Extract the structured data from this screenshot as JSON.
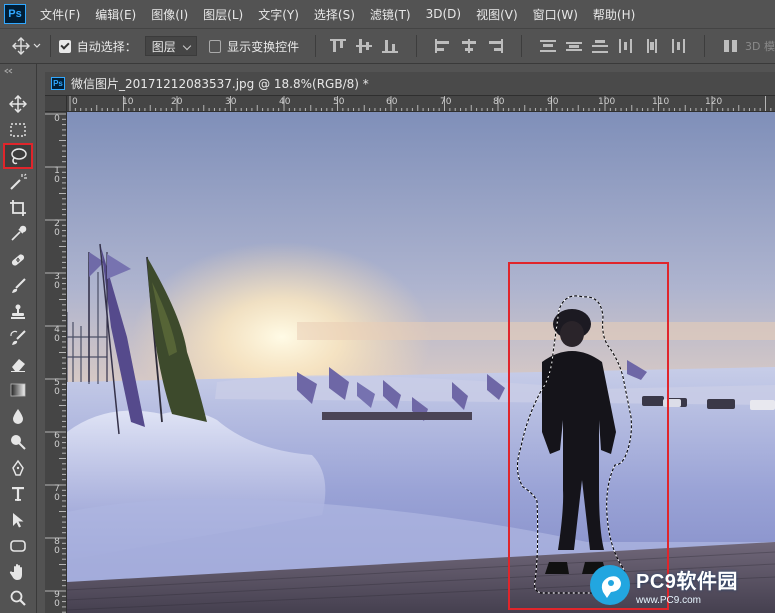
{
  "app": {
    "logo": "Ps"
  },
  "menu": [
    "文件(F)",
    "编辑(E)",
    "图像(I)",
    "图层(L)",
    "文字(Y)",
    "选择(S)",
    "滤镜(T)",
    "3D(D)",
    "视图(V)",
    "窗口(W)",
    "帮助(H)"
  ],
  "options": {
    "auto_select_label": "自动选择：",
    "auto_select_checked": true,
    "auto_select_value": "图层",
    "show_transform_label": "显示变换控件",
    "show_transform_checked": false,
    "mode_3d_label": "3D 模"
  },
  "tools": [
    {
      "name": "move-tool",
      "icon": "move-icon"
    },
    {
      "name": "marquee-tool",
      "icon": "rect-marquee-icon"
    },
    {
      "name": "lasso-tool",
      "icon": "lasso-icon",
      "active": true
    },
    {
      "name": "magic-wand-tool",
      "icon": "magic-wand-icon"
    },
    {
      "name": "crop-tool",
      "icon": "crop-icon"
    },
    {
      "name": "eyedropper-tool",
      "icon": "eyedropper-icon"
    },
    {
      "name": "healing-brush-tool",
      "icon": "bandage-icon"
    },
    {
      "name": "brush-tool",
      "icon": "brush-icon"
    },
    {
      "name": "clone-stamp-tool",
      "icon": "stamp-icon"
    },
    {
      "name": "history-brush-tool",
      "icon": "history-brush-icon"
    },
    {
      "name": "eraser-tool",
      "icon": "eraser-icon"
    },
    {
      "name": "gradient-tool",
      "icon": "gradient-icon"
    },
    {
      "name": "blur-tool",
      "icon": "drop-icon"
    },
    {
      "name": "dodge-tool",
      "icon": "dodge-icon"
    },
    {
      "name": "pen-tool",
      "icon": "pen-icon"
    },
    {
      "name": "type-tool",
      "icon": "type-icon"
    },
    {
      "name": "path-selection-tool",
      "icon": "arrow-icon"
    },
    {
      "name": "shape-tool",
      "icon": "rounded-rect-icon"
    },
    {
      "name": "hand-tool",
      "icon": "hand-icon"
    },
    {
      "name": "zoom-tool",
      "icon": "zoom-icon"
    }
  ],
  "document": {
    "title": "微信图片_20171212083537.jpg @ 18.8%(RGB/8) *",
    "ruler_h": [
      "0",
      "10",
      "20",
      "30",
      "40",
      "50",
      "60",
      "70",
      "80",
      "90",
      "100",
      "110",
      "120"
    ],
    "ruler_v": [
      "0",
      "10",
      "20",
      "30",
      "40",
      "50",
      "60",
      "70",
      "80",
      "90"
    ]
  },
  "highlight_color": "#e0252b",
  "watermark": {
    "name": "PC9软件园",
    "url": "www.PC9.com"
  }
}
